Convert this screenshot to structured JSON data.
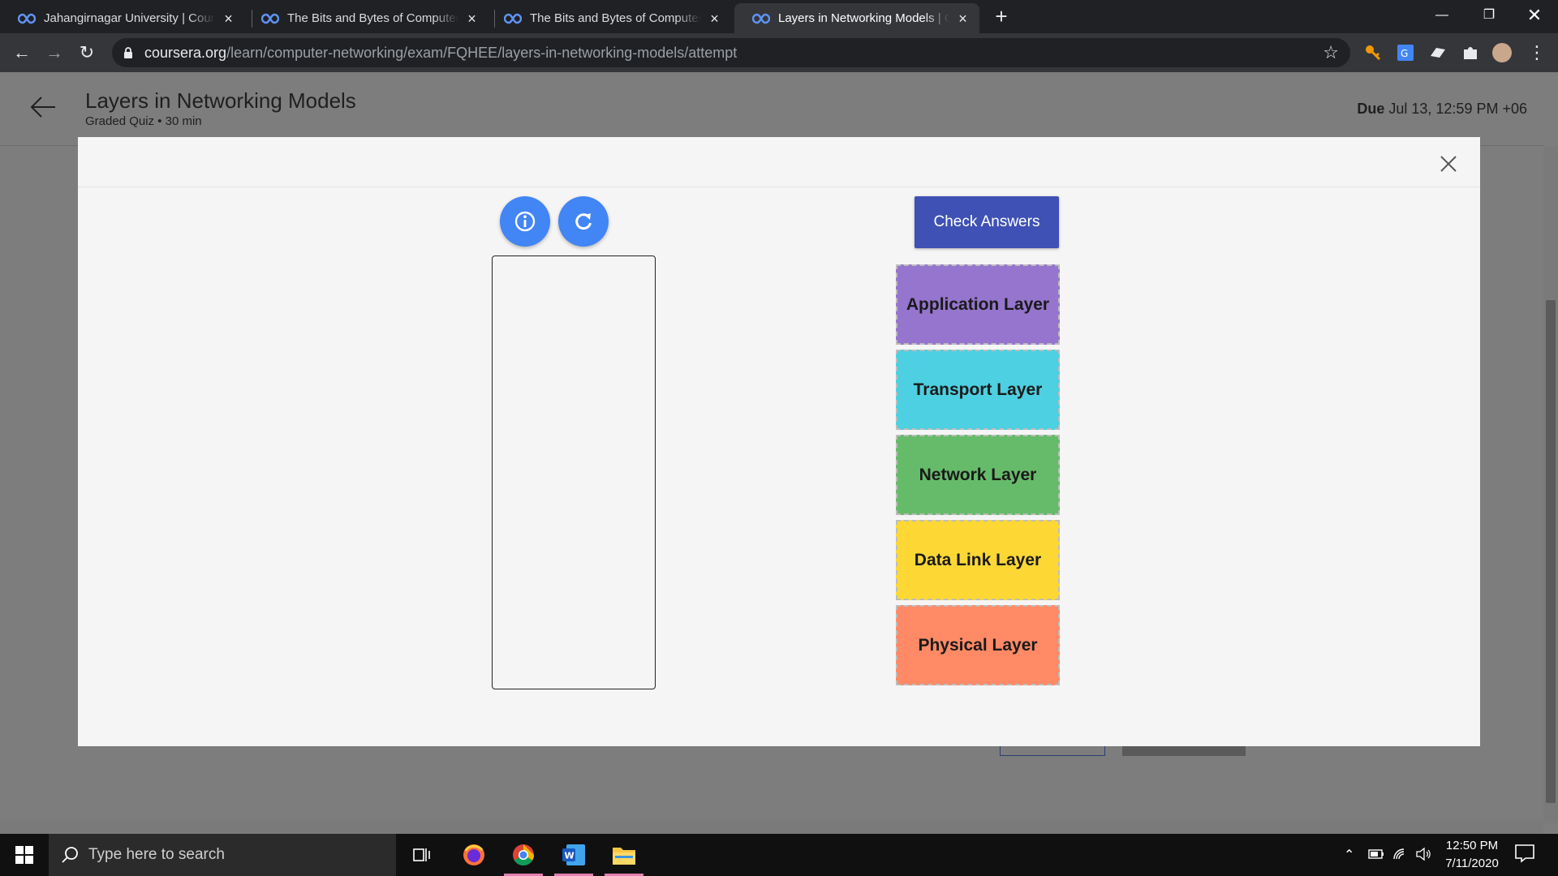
{
  "browser": {
    "tabs": [
      {
        "title": "Jahangirnagar University | Course",
        "active": false
      },
      {
        "title": "The Bits and Bytes of Computer Networking",
        "active": false
      },
      {
        "title": "The Bits and Bytes of Computer Networking",
        "active": false
      },
      {
        "title": "Layers in Networking Models | Coursera",
        "active": true
      }
    ],
    "url_host": "coursera.org",
    "url_path": "/learn/computer-networking/exam/FQHEE/layers-in-networking-models/attempt"
  },
  "page": {
    "title": "Layers in Networking Models",
    "subtitle": "Graded Quiz • 30 min",
    "due_label": "Due",
    "due_value": "Jul 13, 12:59 PM +06"
  },
  "modal": {
    "check_answers_label": "Check Answers",
    "layers": [
      {
        "label": "Application Layer",
        "color": "#9575cd"
      },
      {
        "label": "Transport Layer",
        "color": "#4dd0e1"
      },
      {
        "label": "Network Layer",
        "color": "#66bb6a"
      },
      {
        "label": "Data Link Layer",
        "color": "#fdd835"
      },
      {
        "label": "Physical Layer",
        "color": "#ff8a65"
      }
    ]
  },
  "taskbar": {
    "search_placeholder": "Type here to search",
    "time": "12:50 PM",
    "date": "7/11/2020"
  }
}
